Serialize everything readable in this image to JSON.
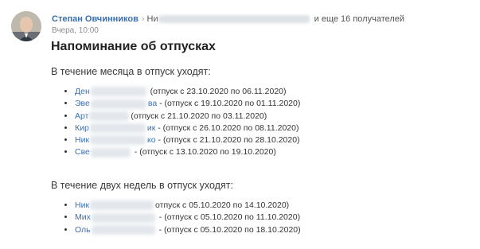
{
  "header": {
    "sender": "Степан Овчинников",
    "recipient_first": "Ни",
    "more_recipients": "и еще 16 получателей",
    "date": "Вчера, 10:00"
  },
  "subject": "Напоминание об отпусках",
  "month_section": {
    "title": "В течение месяца в отпуск уходят:",
    "items": [
      {
        "name": "Ден",
        "sep": "",
        "period": "(отпуск с 23.10.2020 по 06.11.2020)"
      },
      {
        "name": "Эве",
        "name_end": "ва",
        "sep": " - ",
        "period": "(отпуск с 19.10.2020 по 01.11.2020)"
      },
      {
        "name": "Арт",
        "sep": "",
        "period": "(отпуск с 21.10.2020 по 03.11.2020)"
      },
      {
        "name": "Кир",
        "name_end": "ик",
        "sep": " - ",
        "period": "(отпуск с 26.10.2020 по 08.11.2020)"
      },
      {
        "name": "Ник",
        "name_end": "ко",
        "sep": " - ",
        "period": "(отпуск с 21.10.2020 по 28.10.2020)"
      },
      {
        "name": "Све",
        "sep": " - ",
        "period": "(отпуск с 13.10.2020 по 19.10.2020)"
      }
    ]
  },
  "two_weeks_section": {
    "title": "В течение двух недель в отпуск уходят:",
    "items": [
      {
        "name": "Ник",
        "sep": "",
        "period": "отпуск с 05.10.2020 по 14.10.2020)"
      },
      {
        "name": "Мих",
        "sep": " - ",
        "period": "(отпуск с 05.10.2020 по 11.10.2020)"
      },
      {
        "name": "Оль",
        "sep": " - ",
        "period": "(отпуск с 05.10.2020 по 18.10.2020)"
      }
    ]
  },
  "colors": {
    "link": "#3a6fb0",
    "text": "#333333",
    "muted": "#8c8c8c"
  }
}
